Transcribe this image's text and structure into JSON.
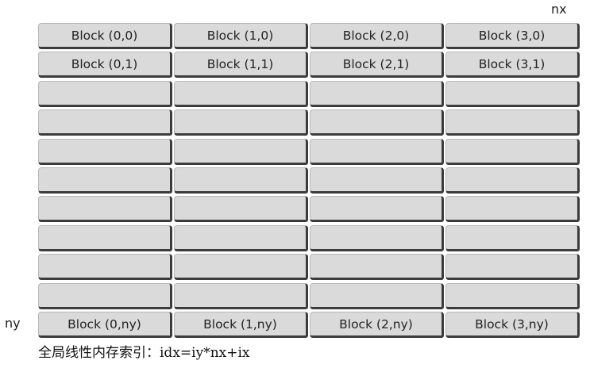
{
  "axes": {
    "x_label": "nx",
    "y_label": "ny"
  },
  "grid": {
    "columns": 4,
    "rows": 11,
    "cells": [
      [
        "Block (0,0)",
        "Block (1,0)",
        "Block (2,0)",
        "Block (3,0)"
      ],
      [
        "Block (0,1)",
        "Block (1,1)",
        "Block (2,1)",
        "Block (3,1)"
      ],
      [
        "",
        "",
        "",
        ""
      ],
      [
        "",
        "",
        "",
        ""
      ],
      [
        "",
        "",
        "",
        ""
      ],
      [
        "",
        "",
        "",
        ""
      ],
      [
        "",
        "",
        "",
        ""
      ],
      [
        "",
        "",
        "",
        ""
      ],
      [
        "",
        "",
        "",
        ""
      ],
      [
        "",
        "",
        "",
        ""
      ],
      [
        "Block (0,ny)",
        "Block (1,ny)",
        "Block (2,ny)",
        "Block (3,ny)"
      ]
    ]
  },
  "caption": "全局线性内存索引：idx=iy*nx+ix"
}
